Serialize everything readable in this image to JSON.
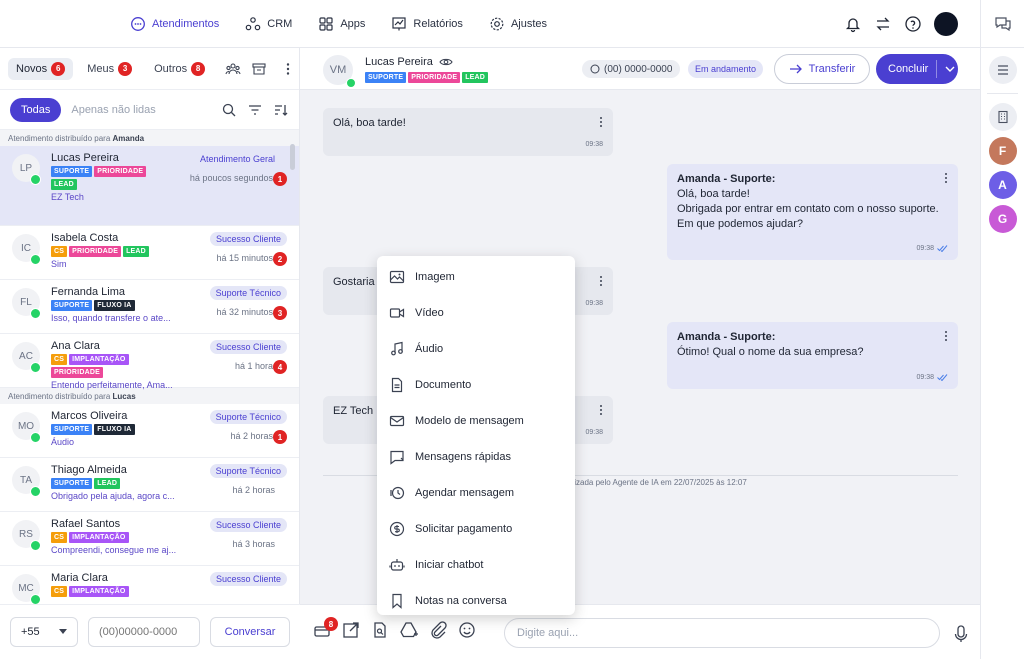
{
  "nav": {
    "items": [
      {
        "label": "Atendimentos",
        "icon": "chat-icon",
        "active": true
      },
      {
        "label": "CRM",
        "icon": "crm-icon"
      },
      {
        "label": "Apps",
        "icon": "apps-icon"
      },
      {
        "label": "Relatórios",
        "icon": "reports-icon"
      },
      {
        "label": "Ajustes",
        "icon": "gear-icon"
      }
    ]
  },
  "right_rail": {
    "letters": [
      "F",
      "A",
      "G"
    ],
    "colors": [
      "#c4785c",
      "#6d5ee6",
      "#c85ad6"
    ]
  },
  "left": {
    "tabs": [
      {
        "label": "Novos",
        "count": "6"
      },
      {
        "label": "Meus",
        "count": "3"
      },
      {
        "label": "Outros",
        "count": "8"
      }
    ],
    "filter_active": "Todas",
    "filter_other": "Apenas não lidas",
    "groups": [
      {
        "prefix": "Atendimento distribuído para",
        "agent": "Amanda",
        "contacts": [
          {
            "initials": "LP",
            "name": "Lucas Pereira",
            "tags": [
              "SUPORTE",
              "PRIORIDADE",
              "LEAD"
            ],
            "preview": "EZ Tech",
            "dept": "Atendimento Geral",
            "time": "há poucos segundos",
            "count": "1",
            "selected": true
          },
          {
            "initials": "IC",
            "name": "Isabela Costa",
            "tags": [
              "CS",
              "PRIORIDADE",
              "LEAD"
            ],
            "preview": "Sim",
            "dept": "Sucesso Cliente",
            "time": "há 15 minutos",
            "count": "2"
          },
          {
            "initials": "FL",
            "name": "Fernanda Lima",
            "tags": [
              "SUPORTE",
              "FLUXO IA"
            ],
            "preview": "Isso, quando transfere o ate...",
            "dept": "Suporte Técnico",
            "time": "há 32 minutos",
            "count": "3"
          },
          {
            "initials": "AC",
            "name": "Ana Clara",
            "tags": [
              "CS",
              "IMPLANTAÇÃO",
              "PRIORIDADE"
            ],
            "preview": "Entendo perfeitamente, Ama...",
            "dept": "Sucesso Cliente",
            "time": "há 1 hora",
            "count": "4"
          }
        ]
      },
      {
        "prefix": "Atendimento distribuído para",
        "agent": "Lucas",
        "contacts": [
          {
            "initials": "MO",
            "name": "Marcos Oliveira",
            "tags": [
              "SUPORTE",
              "FLUXO IA"
            ],
            "preview": "Áudio",
            "dept": "Suporte Técnico",
            "time": "há 2 horas",
            "count": "1"
          },
          {
            "initials": "TA",
            "name": "Thiago Almeida",
            "tags": [
              "SUPORTE",
              "LEAD"
            ],
            "preview": "Obrigado pela ajuda, agora c...",
            "dept": "Suporte Técnico",
            "time": "há 2 horas",
            "count": ""
          },
          {
            "initials": "RS",
            "name": "Rafael Santos",
            "tags": [
              "CS",
              "IMPLANTAÇÃO"
            ],
            "preview": "Compreendi, consegue me aj...",
            "dept": "Sucesso Cliente",
            "time": "há 3 horas",
            "count": ""
          },
          {
            "initials": "MC",
            "name": "Maria Clara",
            "tags": [
              "CS",
              "IMPLANTAÇÃO"
            ],
            "preview": "",
            "dept": "Sucesso Cliente",
            "time": "",
            "count": ""
          }
        ]
      }
    ],
    "tag_colors": {
      "SUPORTE": "#3b82f6",
      "PRIORIDADE": "#ec4899",
      "LEAD": "#22c55e",
      "CS": "#f59e0b",
      "FLUXO IA": "#1f2937",
      "IMPLANTAÇÃO": "#a855f7"
    },
    "country_code": "+55",
    "phone_placeholder": "(00)00000-0000",
    "conversar_label": "Conversar"
  },
  "chat": {
    "contact_initials": "VM",
    "contact_name": "Lucas Pereira",
    "contact_tags": [
      "SUPORTE",
      "PRIORIDADE",
      "LEAD"
    ],
    "phone": "(00) 0000-0000",
    "status": "Em andamento",
    "transfer_label": "Transferir",
    "conclude_label": "Concluir",
    "messages": [
      {
        "dir": "in",
        "text": "Olá, boa tarde!",
        "time": "09:38"
      },
      {
        "dir": "out",
        "author": "Amanda - Suporte:",
        "lines": [
          "Olá, boa tarde!",
          "Obrigada por entrar em contato com o nosso suporte.",
          "Em que podemos ajudar?"
        ],
        "time": "09:38"
      },
      {
        "dir": "in",
        "text": "Gostaria",
        "time": "09:38"
      },
      {
        "dir": "out",
        "author": "Amanda - Suporte:",
        "lines": [
          "Ótimo! Qual o nome da sua empresa?"
        ],
        "time": "09:38"
      },
      {
        "dir": "in",
        "text": "EZ Tech",
        "time": "09:38"
      }
    ],
    "divider_text": "alizada pelo Agente de IA em 22/07/2025 às 12:07",
    "footer_badge": "8",
    "input_placeholder": "Digite aqui..."
  },
  "menu": {
    "items": [
      {
        "label": "Imagem",
        "icon": "image-icon"
      },
      {
        "label": "Vídeo",
        "icon": "video-icon"
      },
      {
        "label": "Áudio",
        "icon": "music-note-icon"
      },
      {
        "label": "Documento",
        "icon": "document-icon"
      },
      {
        "label": "Modelo de mensagem",
        "icon": "envelope-icon"
      },
      {
        "label": "Mensagens rápidas",
        "icon": "quick-message-icon"
      },
      {
        "label": "Agendar mensagem",
        "icon": "clock-icon"
      },
      {
        "label": "Solicitar pagamento",
        "icon": "dollar-icon"
      },
      {
        "label": "Iniciar chatbot",
        "icon": "robot-icon"
      },
      {
        "label": "Notas na conversa",
        "icon": "bookmark-icon"
      }
    ]
  }
}
